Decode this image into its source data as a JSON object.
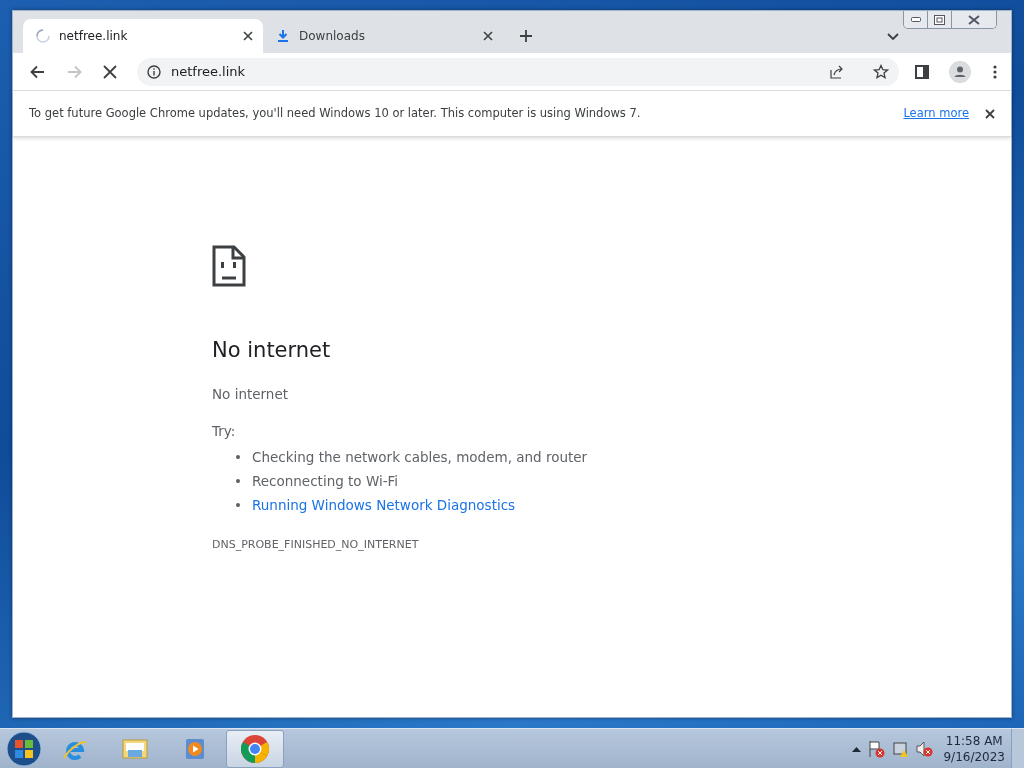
{
  "tabs": [
    {
      "title": "netfree.link",
      "kind": "loading",
      "selected": true
    },
    {
      "title": "Downloads",
      "kind": "download",
      "selected": false
    }
  ],
  "toolbar": {
    "nav_buttons": [
      {
        "kind": "back",
        "disabled": false
      },
      {
        "kind": "forward",
        "disabled": true
      },
      {
        "kind": "stop",
        "disabled": false
      }
    ],
    "url": "netfree.link"
  },
  "infobar": {
    "message": "To get future Google Chrome updates, you'll need Windows 10 or later. This computer is using Windows 7.",
    "link": "Learn more"
  },
  "error_page": {
    "title": "No internet",
    "subtitle": "No internet",
    "try_label": "Try:",
    "suggestions": [
      {
        "marker": "•",
        "text": "Checking the network cables, modem, and router",
        "kind": "text"
      },
      {
        "marker": "•",
        "text": "Reconnecting to Wi-Fi",
        "kind": "text"
      },
      {
        "marker": "•",
        "text": "Running Windows Network Diagnostics",
        "kind": "link"
      }
    ],
    "error_code": "DNS_PROBE_FINISHED_NO_INTERNET"
  },
  "taskbar": {
    "apps": [
      {
        "kind": "ie",
        "selected": false
      },
      {
        "kind": "folder",
        "selected": false
      },
      {
        "kind": "media",
        "selected": false
      },
      {
        "kind": "chrome",
        "selected": true
      }
    ],
    "clock": {
      "time": "11:58 AM",
      "date": "9/16/2023"
    }
  }
}
